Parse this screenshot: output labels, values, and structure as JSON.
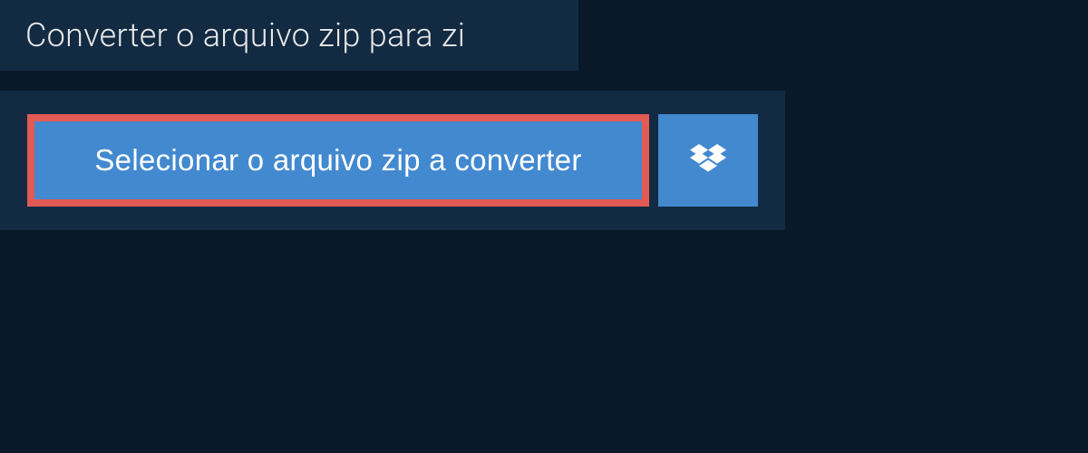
{
  "header": {
    "title": "Converter o arquivo zip para zi"
  },
  "actions": {
    "select_label": "Selecionar o arquivo zip a converter"
  },
  "colors": {
    "background": "#0a1929",
    "panel": "#122a42",
    "button": "#4289d0",
    "highlight_border": "#e15a54"
  }
}
